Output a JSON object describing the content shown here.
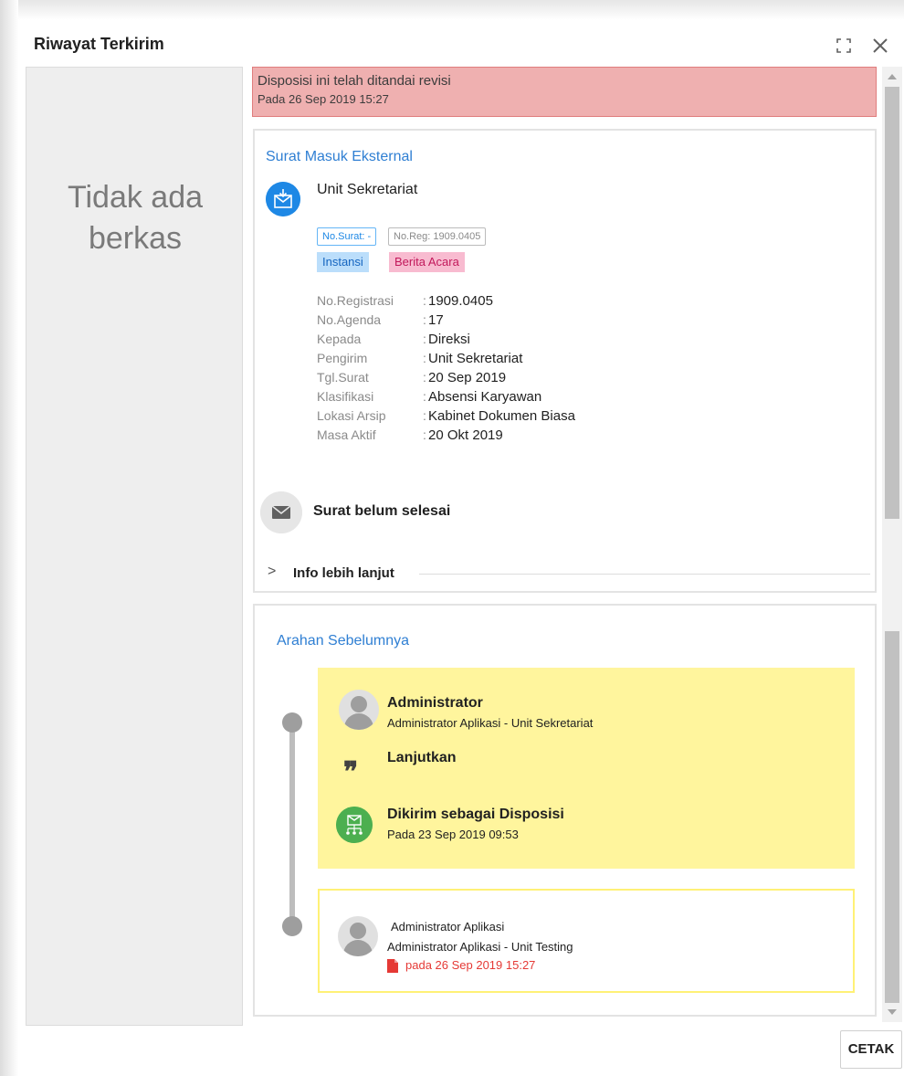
{
  "dialog": {
    "title": "Riwayat Terkirim"
  },
  "left_pane": {
    "empty_text": "Tidak ada\nberkas"
  },
  "revisi": {
    "title": "Disposisi ini telah ditandai revisi",
    "date": "Pada 26 Sep 2019 15:27"
  },
  "surat": {
    "section_title": "Surat Masuk Eksternal",
    "unit": "Unit Sekretariat",
    "tags": {
      "no_surat": "No.Surat: -",
      "no_reg": "No.Reg: 1909.0405",
      "instansi": "Instansi",
      "berita_acara": "Berita Acara"
    },
    "info": [
      {
        "key": "No.Registrasi",
        "value": "1909.0405"
      },
      {
        "key": "No.Agenda",
        "value": "17"
      },
      {
        "key": "Kepada",
        "value": "Direksi"
      },
      {
        "key": "Pengirim",
        "value": "Unit Sekretariat"
      },
      {
        "key": "Tgl.Surat",
        "value": "20 Sep 2019"
      },
      {
        "key": "Klasifikasi",
        "value": "Absensi Karyawan"
      },
      {
        "key": "Lokasi Arsip",
        "value": "Kabinet Dokumen Biasa"
      },
      {
        "key": "Masa Aktif",
        "value": "20 Okt 2019"
      }
    ],
    "colon": ":",
    "status": "Surat belum selesai",
    "more_info": "Info lebih lanjut",
    "chevron": ">"
  },
  "arahan": {
    "title": "Arahan Sebelumnya",
    "entry1": {
      "name": "Administrator",
      "role": "Administrator Aplikasi - Unit Sekretariat",
      "quote_mark": "❞",
      "instruction": "Lanjutkan",
      "sent_as": "Dikirim sebagai Disposisi",
      "sent_date": "Pada 23 Sep 2019 09:53"
    },
    "entry2": {
      "name": "Administrator Aplikasi",
      "role": "Administrator Aplikasi - Unit Testing",
      "date": "pada 26 Sep 2019 15:27"
    }
  },
  "buttons": {
    "cetak": "CETAK"
  },
  "colors": {
    "accent_blue": "#2f7fd3",
    "revisi_bg": "#efb0b0",
    "yellow_card": "#fff59d",
    "green": "#4caf50",
    "red_date": "#e53935"
  },
  "icons": {
    "fullscreen": "fullscreen-icon",
    "close": "close-icon",
    "mail": "mail-download-icon",
    "envelope": "envelope-icon",
    "quote": "quote-icon",
    "disposisi": "disposisi-icon",
    "file": "file-icon"
  }
}
